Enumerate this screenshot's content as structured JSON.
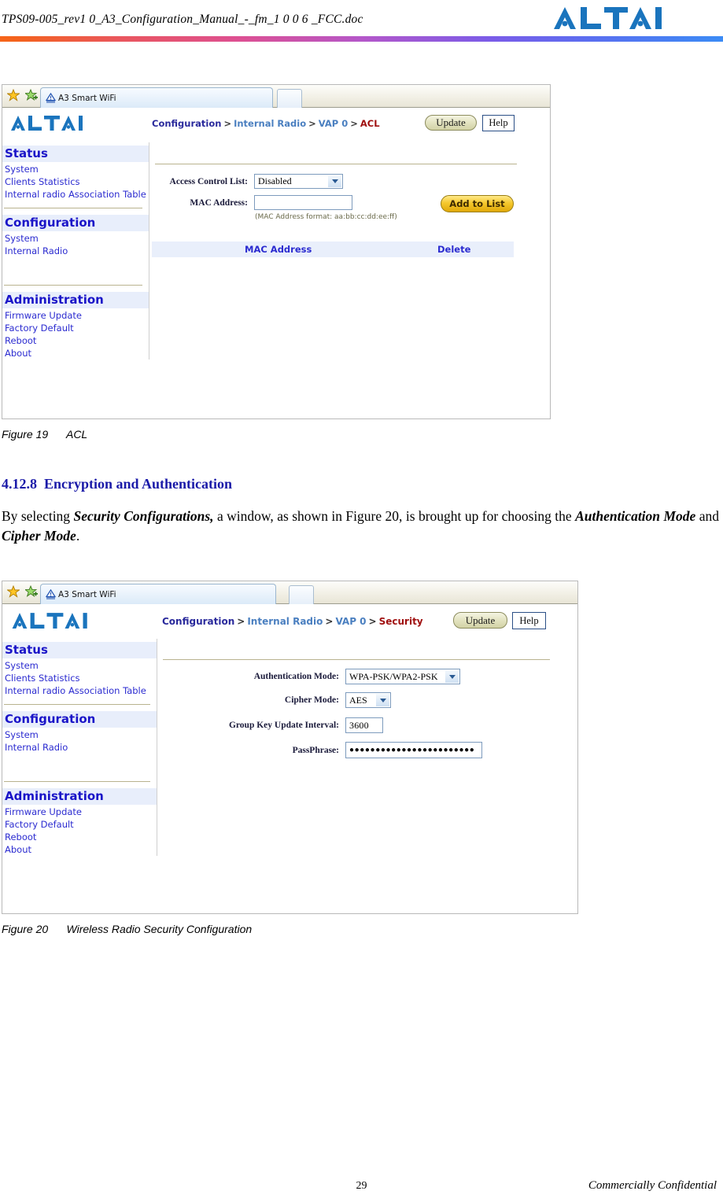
{
  "document": {
    "header_title": "TPS09-005_rev1 0_A3_Configuration_Manual_-_fm_1 0 0 6 _FCC.doc",
    "logo_text": "ALTAI",
    "page_number": "29",
    "confidentiality": "Commercially Confidential",
    "header_rule_colors": [
      "#f6651a",
      "#dd5092",
      "#b457c9",
      "#7a5ce8",
      "#3b8bf5"
    ]
  },
  "section": {
    "number": "4.12.8",
    "title": "Encryption and Authentication",
    "paragraph_parts": [
      {
        "text": "By selecting ",
        "bold": false
      },
      {
        "text": "Security Configurations,",
        "bold": true
      },
      {
        "text": " a window, as shown in Figure 20, is brought up for choosing the ",
        "bold": false
      },
      {
        "text": "Authentication Mode",
        "bold": true
      },
      {
        "text": " and ",
        "bold": false
      },
      {
        "text": "Cipher Mode",
        "bold": true
      },
      {
        "text": ".",
        "bold": false
      }
    ]
  },
  "figure19": {
    "caption_label": "Figure 19",
    "caption_text": "ACL",
    "browser": {
      "tab_label": "A3 Smart WiFi",
      "favorites_icon": "star-icon",
      "add_favorite_icon": "star-plus-icon"
    },
    "banner": {
      "logo": "ALTAI",
      "breadcrumb": {
        "root": "Configuration",
        "sep": ">",
        "level2": "Internal Radio",
        "level3": "VAP 0",
        "current": "ACL"
      },
      "update_label": "Update",
      "help_label": "Help"
    },
    "sidebar": [
      {
        "type": "head",
        "label": "Status"
      },
      {
        "type": "item",
        "label": "System"
      },
      {
        "type": "item",
        "label": "Clients Statistics"
      },
      {
        "type": "item",
        "label": "Internal radio Association Table"
      },
      {
        "type": "divider"
      },
      {
        "type": "head",
        "label": "Configuration"
      },
      {
        "type": "item",
        "label": "System"
      },
      {
        "type": "item",
        "label": "Internal Radio"
      },
      {
        "type": "spacer"
      },
      {
        "type": "divider"
      },
      {
        "type": "head",
        "label": "Administration"
      },
      {
        "type": "item",
        "label": "Firmware Update"
      },
      {
        "type": "item",
        "label": "Factory Default"
      },
      {
        "type": "item",
        "label": "Reboot"
      },
      {
        "type": "item",
        "label": "About"
      }
    ],
    "form": {
      "acl_label": "Access Control List:",
      "acl_value": "Disabled",
      "acl_options": [
        "Disabled"
      ],
      "mac_label": "MAC Address:",
      "mac_value": "",
      "mac_placeholder": "",
      "mac_hint": "(MAC Address format: aa:bb:cc:dd:ee:ff)",
      "add_button": "Add to List"
    },
    "table": {
      "col_mac": "MAC Address",
      "col_delete": "Delete",
      "rows": []
    }
  },
  "figure20": {
    "caption_label": "Figure 20",
    "caption_text": "Wireless Radio Security Configuration",
    "browser": {
      "tab_label": "A3 Smart WiFi",
      "favorites_icon": "star-icon",
      "add_favorite_icon": "star-plus-icon"
    },
    "banner": {
      "logo": "ALTAI",
      "breadcrumb": {
        "root": "Configuration",
        "sep": ">",
        "level2": "Internal Radio",
        "level3": "VAP 0",
        "current": "Security"
      },
      "update_label": "Update",
      "help_label": "Help"
    },
    "sidebar": [
      {
        "type": "head",
        "label": "Status"
      },
      {
        "type": "item",
        "label": "System"
      },
      {
        "type": "item",
        "label": "Clients Statistics"
      },
      {
        "type": "item",
        "label": "Internal radio Association Table"
      },
      {
        "type": "divider"
      },
      {
        "type": "head",
        "label": "Configuration"
      },
      {
        "type": "item",
        "label": "System"
      },
      {
        "type": "item",
        "label": "Internal Radio"
      },
      {
        "type": "spacer"
      },
      {
        "type": "divider"
      },
      {
        "type": "head",
        "label": "Administration"
      },
      {
        "type": "item",
        "label": "Firmware Update"
      },
      {
        "type": "item",
        "label": "Factory Default"
      },
      {
        "type": "item",
        "label": "Reboot"
      },
      {
        "type": "item",
        "label": "About"
      }
    ],
    "form": {
      "auth_label": "Authentication Mode:",
      "auth_value": "WPA-PSK/WPA2-PSK",
      "cipher_label": "Cipher Mode:",
      "cipher_value": "AES",
      "gkui_label": "Group Key Update Interval:",
      "gkui_value": "3600",
      "pass_label": "PassPhrase:",
      "pass_value": "●●●●●●●●●●●●●●●●●●●●●●●●"
    }
  }
}
